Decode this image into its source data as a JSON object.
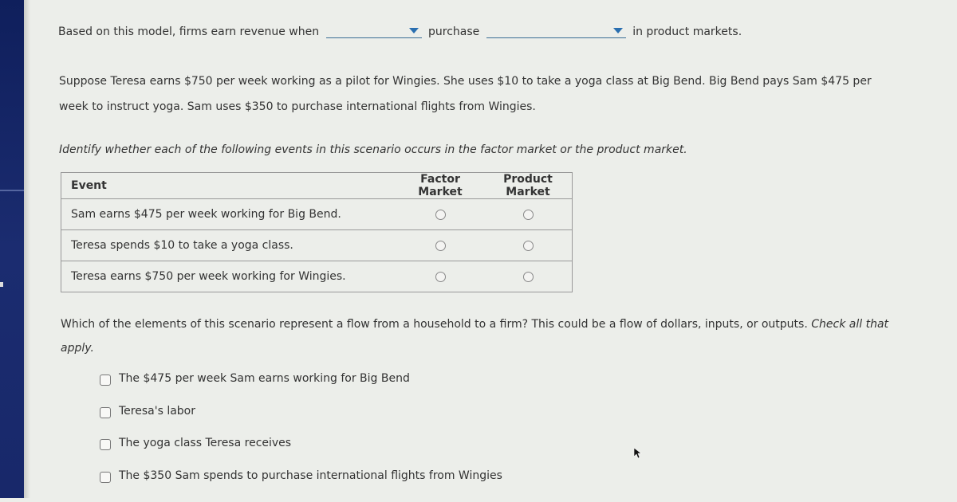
{
  "question1": {
    "prefix": "Based on this model, firms earn revenue when",
    "dropdown1_value": "",
    "middle": "purchase",
    "dropdown2_value": "",
    "suffix": "in product markets."
  },
  "scenario": {
    "text": "Suppose Teresa earns $750 per week working as a pilot for Wingies. She uses $10 to take a yoga class at Big Bend. Big Bend pays Sam $475 per week to instruct yoga. Sam uses $350 to purchase international flights from Wingies."
  },
  "question2": {
    "instruction": "Identify whether each of the following events in this scenario occurs in the factor market or the product market.",
    "headers": {
      "event": "Event",
      "factor": "Factor Market",
      "product": "Product Market"
    },
    "rows": [
      {
        "event": "Sam earns $475 per week working for Big Bend.",
        "selected": null
      },
      {
        "event": "Teresa spends $10 to take a yoga class.",
        "selected": null
      },
      {
        "event": "Teresa earns $750 per week working for Wingies.",
        "selected": null
      }
    ]
  },
  "question3": {
    "prompt": "Which of the elements of this scenario represent a flow from a household to a firm? This could be a flow of dollars, inputs, or outputs.",
    "emphasis": "Check all that apply.",
    "options": [
      {
        "label": "The $475 per week Sam earns working for Big Bend",
        "checked": false
      },
      {
        "label": "Teresa's labor",
        "checked": false
      },
      {
        "label": "The yoga class Teresa receives",
        "checked": false
      },
      {
        "label": "The $350 Sam spends to purchase international flights from Wingies",
        "checked": false
      }
    ]
  },
  "colors": {
    "accent": "#2a6fb0",
    "sidebar": "#1b2c70",
    "background": "#eceeea"
  }
}
